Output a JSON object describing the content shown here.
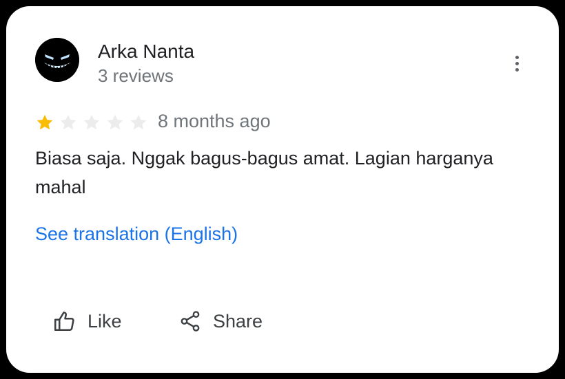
{
  "review": {
    "author": {
      "name": "Arka Nanta",
      "reviews_count_text": "3 reviews",
      "avatar_icon": "glowing-grin-face-avatar"
    },
    "rating": {
      "value": 1,
      "max": 5,
      "filled_color": "#FBBC04",
      "empty_color": "#ECECEC"
    },
    "timestamp": "8 months ago",
    "text": "Biasa saja. Nggak bagus-bagus amat. Lagian harganya mahal",
    "translate_link": "See translation (English)",
    "menu_icon": "more-vert-icon"
  },
  "actions": {
    "like_label": "Like",
    "like_icon": "thumb-up-icon",
    "share_label": "Share",
    "share_icon": "share-icon"
  },
  "colors": {
    "link": "#1a73e8",
    "primary_text": "#202124",
    "secondary_text": "#70757a"
  }
}
